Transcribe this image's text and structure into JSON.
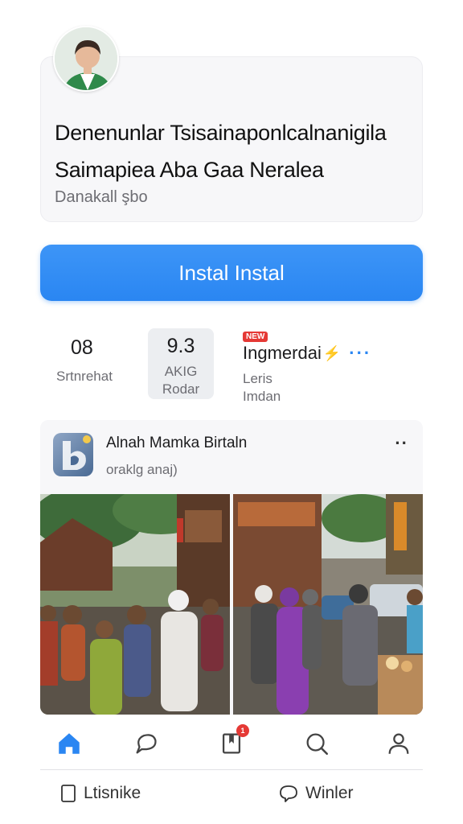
{
  "app": {
    "title_line1": "Denenunlar Tsisainaponlcalnanigila",
    "title_line2": "Saimapiea Aba Gaa Neralea",
    "subtitle": "Danakall şbo"
  },
  "install": {
    "label": "Instal Instal"
  },
  "stats": {
    "rating": {
      "value": "08",
      "label": "Srtnrehat"
    },
    "score": {
      "value": "9.3",
      "label_line1": "AKIG",
      "label_line2": "Rodar"
    },
    "developer": {
      "badge": "NEW",
      "name": "Ingmerdai",
      "label_line1": "Leris",
      "label_line2": "Imdan"
    }
  },
  "post": {
    "title": "Alnah Mamka Birtaln",
    "subtitle": "oraklg anaj)",
    "more_icon": "more-dots-icon"
  },
  "tabs": {
    "items": [
      {
        "name": "home",
        "icon": "home-icon",
        "active": true
      },
      {
        "name": "chat",
        "icon": "chat-icon",
        "active": false
      },
      {
        "name": "bookmark",
        "icon": "bookmark-icon",
        "active": false,
        "badge": "1"
      },
      {
        "name": "search",
        "icon": "search-icon",
        "active": false
      },
      {
        "name": "profile",
        "icon": "profile-icon",
        "active": false
      }
    ]
  },
  "bottom_actions": {
    "left_label": "Ltisnike",
    "right_label": "Winler"
  },
  "colors": {
    "accent": "#2a86f2",
    "badge_red": "#e53935",
    "card_bg": "#f7f7f9",
    "muted_text": "#6d6d73"
  }
}
